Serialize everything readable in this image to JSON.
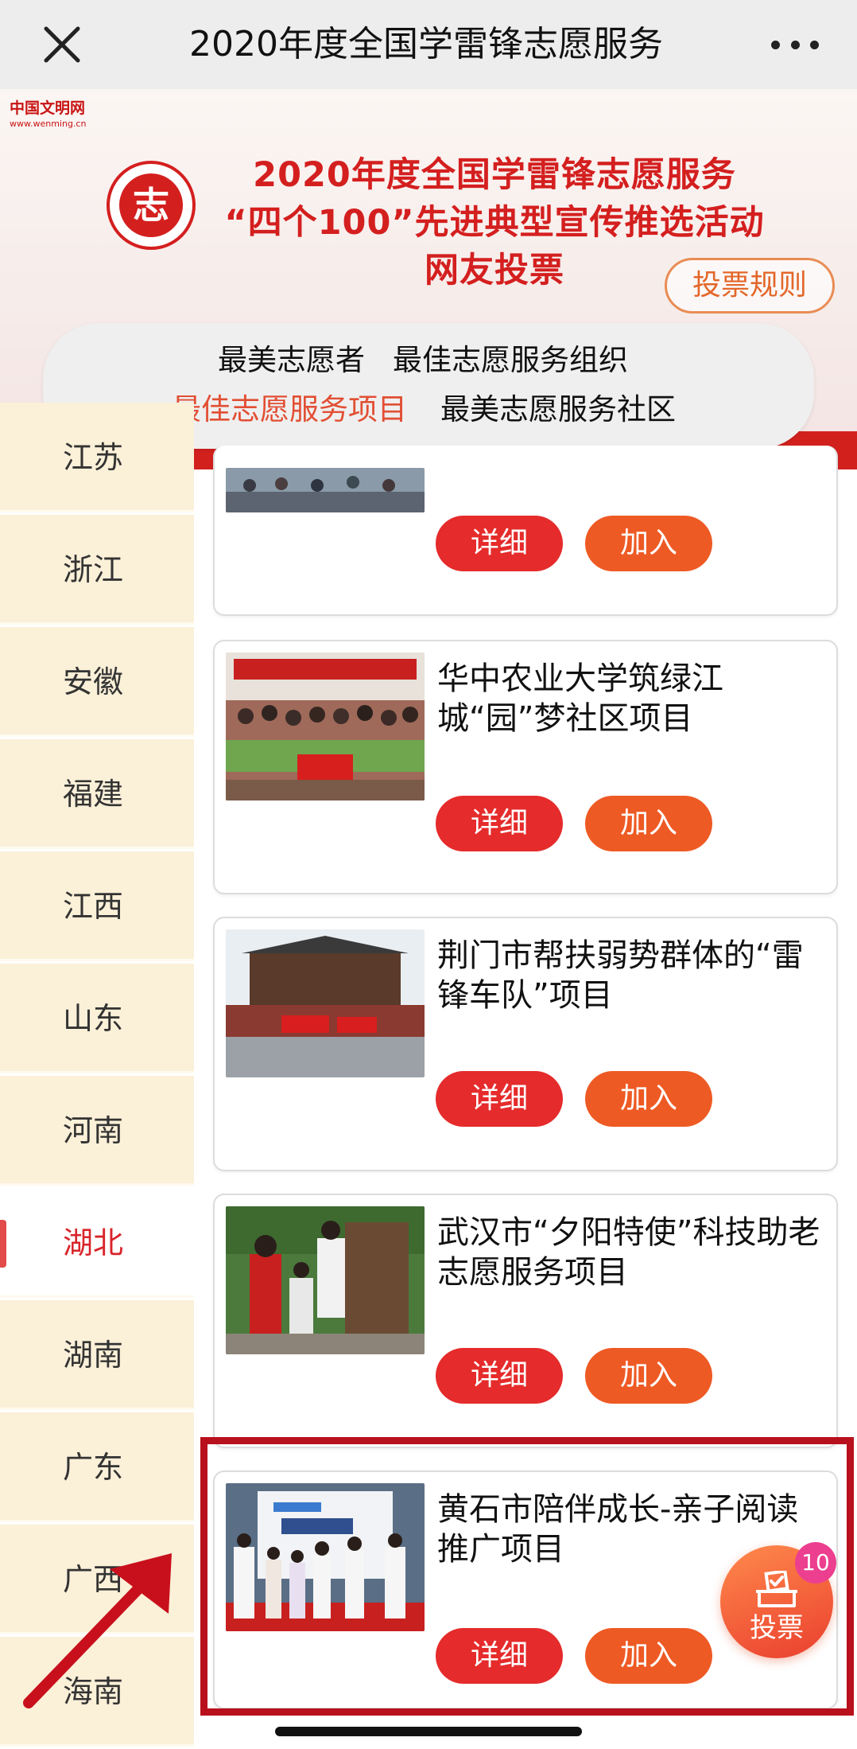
{
  "navbar": {
    "title": "2020年度全国学雷锋志愿服务",
    "close_icon": "close-icon",
    "more_icon": "more-dots-icon"
  },
  "banner": {
    "site_logo_line1": "中国文明网",
    "site_logo_line2": "www.wenming.cn",
    "emblem_char": "志",
    "title_line1": "2020年度全国学雷锋志愿服务",
    "title_line2": "“四个100”先进典型宣传推选活动",
    "title_line3": "网友投票",
    "rules_label": "投票规则"
  },
  "categories": [
    {
      "label": "最美志愿者",
      "active": false
    },
    {
      "label": "最佳志愿服务组织",
      "active": false
    },
    {
      "label": "最佳志愿服务项目",
      "active": true
    },
    {
      "label": "最美志愿服务社区",
      "active": false
    }
  ],
  "sidebar": {
    "items": [
      {
        "label": "江苏",
        "active": false
      },
      {
        "label": "浙江",
        "active": false
      },
      {
        "label": "安徽",
        "active": false
      },
      {
        "label": "福建",
        "active": false
      },
      {
        "label": "江西",
        "active": false
      },
      {
        "label": "山东",
        "active": false
      },
      {
        "label": "河南",
        "active": false
      },
      {
        "label": "湖北",
        "active": true
      },
      {
        "label": "湖南",
        "active": false
      },
      {
        "label": "广东",
        "active": false
      },
      {
        "label": "广西",
        "active": false
      },
      {
        "label": "海南",
        "active": false
      }
    ]
  },
  "cards": [
    {
      "title": "",
      "detail_label": "详细",
      "join_label": "加入"
    },
    {
      "title": "华中农业大学筑绿江城“园”梦社区项目",
      "detail_label": "详细",
      "join_label": "加入"
    },
    {
      "title": "荆门市帮扶弱势群体的“雷锋车队”项目",
      "detail_label": "详细",
      "join_label": "加入"
    },
    {
      "title": "武汉市“夕阳特使”科技助老志愿服务项目",
      "detail_label": "详细",
      "join_label": "加入"
    },
    {
      "title": "黄石市陪伴成长-亲子阅读推广项目",
      "detail_label": "详细",
      "join_label": "加入"
    }
  ],
  "fab": {
    "label": "投票",
    "badge": "10",
    "icon": "ballot-box-icon"
  },
  "colors": {
    "accent_red": "#e52b2b",
    "accent_orange": "#ee5a24",
    "sidebar_bg": "#fbf0d8",
    "highlight_border": "#b8101c"
  }
}
